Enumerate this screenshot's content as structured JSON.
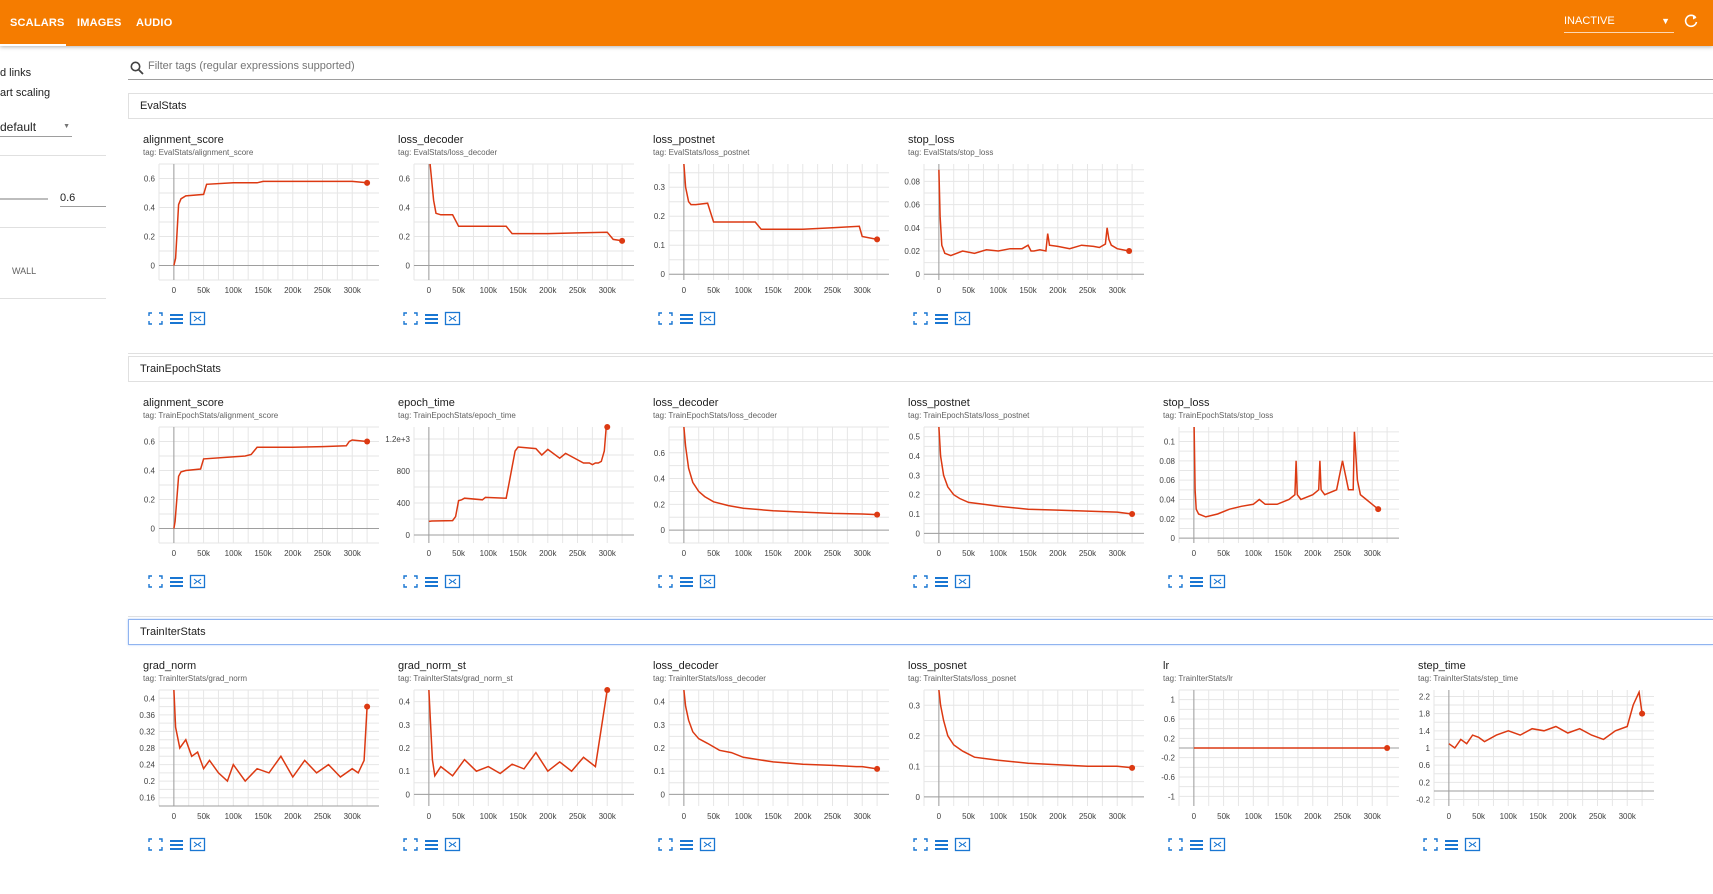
{
  "header": {
    "tabs": [
      {
        "label": "SCALARS",
        "active": true
      },
      {
        "label": "IMAGES",
        "active": false
      },
      {
        "label": "AUDIO",
        "active": false
      }
    ],
    "status_value": "INACTIVE",
    "bar_color": "#f57c00"
  },
  "sidebar": {
    "option_links": "d links",
    "option_scaling": "art scaling",
    "tooltip_sorting": "default",
    "smoothing_value": "0.6",
    "axis_wall": "WALL"
  },
  "search": {
    "placeholder": "Filter tags (regular expressions supported)"
  },
  "groups": [
    {
      "name": "EvalStats",
      "selected": false
    },
    {
      "name": "TrainEpochStats",
      "selected": false
    },
    {
      "name": "TrainIterStats",
      "selected": true
    }
  ],
  "series_color": "#dc3912",
  "cards": [
    {
      "title": "alignment_score",
      "tag": "tag: EvalStats/alignment_score",
      "yticks": [
        "0.6",
        "0.4",
        "0.2",
        "0"
      ],
      "xticks": [
        "0",
        "50k",
        "100k",
        "150k",
        "200k",
        "250k",
        "300k"
      ]
    },
    {
      "title": "loss_decoder",
      "tag": "tag: EvalStats/loss_decoder",
      "yticks": [
        "0.6",
        "0.4",
        "0.2",
        "0"
      ],
      "xticks": [
        "0",
        "50k",
        "100k",
        "150k",
        "200k",
        "250k",
        "300k"
      ]
    },
    {
      "title": "loss_postnet",
      "tag": "tag: EvalStats/loss_postnet",
      "yticks": [
        "0.3",
        "0.2",
        "0.1",
        "0"
      ],
      "xticks": [
        "0",
        "50k",
        "100k",
        "150k",
        "200k",
        "250k",
        "300k"
      ]
    },
    {
      "title": "stop_loss",
      "tag": "tag: EvalStats/stop_loss",
      "yticks": [
        "0.08",
        "0.06",
        "0.04",
        "0.02",
        "0"
      ],
      "xticks": [
        "0",
        "50k",
        "100k",
        "150k",
        "200k",
        "250k",
        "300k"
      ]
    },
    {
      "title": "alignment_score",
      "tag": "tag: TrainEpochStats/alignment_score",
      "yticks": [
        "0.6",
        "0.4",
        "0.2",
        "0"
      ],
      "xticks": [
        "0",
        "50k",
        "100k",
        "150k",
        "200k",
        "250k",
        "300k"
      ]
    },
    {
      "title": "epoch_time",
      "tag": "tag: TrainEpochStats/epoch_time",
      "yticks": [
        "1.2e+3",
        "800",
        "400",
        "0"
      ],
      "xticks": [
        "0",
        "50k",
        "100k",
        "150k",
        "200k",
        "250k",
        "300k"
      ]
    },
    {
      "title": "loss_decoder",
      "tag": "tag: TrainEpochStats/loss_decoder",
      "yticks": [
        "0.6",
        "0.4",
        "0.2",
        "0"
      ],
      "xticks": [
        "0",
        "50k",
        "100k",
        "150k",
        "200k",
        "250k",
        "300k"
      ]
    },
    {
      "title": "loss_postnet",
      "tag": "tag: TrainEpochStats/loss_postnet",
      "yticks": [
        "0.5",
        "0.4",
        "0.3",
        "0.2",
        "0.1",
        "0"
      ],
      "xticks": [
        "0",
        "50k",
        "100k",
        "150k",
        "200k",
        "250k",
        "300k"
      ]
    },
    {
      "title": "stop_loss",
      "tag": "tag: TrainEpochStats/stop_loss",
      "yticks": [
        "0.1",
        "0.08",
        "0.06",
        "0.04",
        "0.02",
        "0"
      ],
      "xticks": [
        "0",
        "50k",
        "100k",
        "150k",
        "200k",
        "250k",
        "300k"
      ]
    },
    {
      "title": "grad_norm",
      "tag": "tag: TrainIterStats/grad_norm",
      "yticks": [
        "0.4",
        "0.36",
        "0.32",
        "0.28",
        "0.24",
        "0.2",
        "0.16"
      ],
      "xticks": [
        "0",
        "50k",
        "100k",
        "150k",
        "200k",
        "250k",
        "300k"
      ]
    },
    {
      "title": "grad_norm_st",
      "tag": "tag: TrainIterStats/grad_norm_st",
      "yticks": [
        "0.4",
        "0.3",
        "0.2",
        "0.1",
        "0"
      ],
      "xticks": [
        "0",
        "50k",
        "100k",
        "150k",
        "200k",
        "250k",
        "300k"
      ]
    },
    {
      "title": "loss_decoder",
      "tag": "tag: TrainIterStats/loss_decoder",
      "yticks": [
        "0.4",
        "0.3",
        "0.2",
        "0.1",
        "0"
      ],
      "xticks": [
        "0",
        "50k",
        "100k",
        "150k",
        "200k",
        "250k",
        "300k"
      ]
    },
    {
      "title": "loss_posnet",
      "tag": "tag: TrainIterStats/loss_posnet",
      "yticks": [
        "0.3",
        "0.2",
        "0.1",
        "0"
      ],
      "xticks": [
        "0",
        "50k",
        "100k",
        "150k",
        "200k",
        "250k",
        "300k"
      ]
    },
    {
      "title": "lr",
      "tag": "tag: TrainIterStats/lr",
      "yticks": [
        "1",
        "0.6",
        "0.2",
        "-0.2",
        "-0.6",
        "-1"
      ],
      "xticks": [
        "0",
        "50k",
        "100k",
        "150k",
        "200k",
        "250k",
        "300k"
      ]
    },
    {
      "title": "step_time",
      "tag": "tag: TrainIterStats/step_time",
      "yticks": [
        "2.2",
        "1.8",
        "1.4",
        "1",
        "0.6",
        "0.2",
        "-0.2"
      ],
      "xticks": [
        "0",
        "50k",
        "100k",
        "150k",
        "200k",
        "250k",
        "300k"
      ]
    }
  ],
  "chart_data": [
    {
      "type": "line",
      "x": [
        0,
        3000,
        8000,
        12000,
        20000,
        50000,
        55000,
        100000,
        140000,
        150000,
        200000,
        250000,
        300000,
        325000
      ],
      "series": [
        {
          "values": [
            0,
            0.05,
            0.42,
            0.46,
            0.48,
            0.49,
            0.56,
            0.57,
            0.57,
            0.58,
            0.58,
            0.58,
            0.58,
            0.57
          ]
        }
      ],
      "ylim": [
        -0.1,
        0.7
      ],
      "xlim": [
        -25000,
        345000
      ]
    },
    {
      "type": "line",
      "x": [
        0,
        2000,
        8000,
        12000,
        20000,
        40000,
        50000,
        100000,
        130000,
        140000,
        200000,
        250000,
        300000,
        310000,
        325000
      ],
      "series": [
        {
          "values": [
            0.9,
            0.7,
            0.45,
            0.36,
            0.35,
            0.35,
            0.27,
            0.27,
            0.27,
            0.22,
            0.22,
            0.225,
            0.23,
            0.18,
            0.17
          ]
        }
      ],
      "ylim": [
        -0.1,
        0.7
      ],
      "xlim": [
        -25000,
        345000
      ]
    },
    {
      "type": "line",
      "x": [
        0,
        3000,
        8000,
        12000,
        20000,
        40000,
        50000,
        100000,
        120000,
        130000,
        200000,
        250000,
        295000,
        300000,
        325000
      ],
      "series": [
        {
          "values": [
            0.38,
            0.3,
            0.25,
            0.24,
            0.24,
            0.245,
            0.18,
            0.18,
            0.18,
            0.155,
            0.155,
            0.16,
            0.165,
            0.13,
            0.12
          ]
        }
      ],
      "ylim": [
        -0.02,
        0.38
      ],
      "xlim": [
        -25000,
        345000
      ]
    },
    {
      "type": "line",
      "x": [
        0,
        2000,
        5000,
        10000,
        20000,
        40000,
        60000,
        80000,
        100000,
        120000,
        140000,
        150000,
        155000,
        160000,
        170000,
        180000,
        183000,
        186000,
        200000,
        220000,
        240000,
        260000,
        270000,
        280000,
        283000,
        286000,
        290000,
        300000,
        320000
      ],
      "series": [
        {
          "values": [
            0.09,
            0.05,
            0.025,
            0.018,
            0.016,
            0.02,
            0.018,
            0.021,
            0.02,
            0.022,
            0.022,
            0.025,
            0.02,
            0.02,
            0.021,
            0.02,
            0.035,
            0.025,
            0.024,
            0.022,
            0.025,
            0.024,
            0.023,
            0.026,
            0.04,
            0.03,
            0.025,
            0.022,
            0.02
          ]
        }
      ],
      "ylim": [
        -0.005,
        0.095
      ],
      "xlim": [
        -25000,
        345000
      ]
    },
    {
      "type": "line",
      "x": [
        0,
        2000,
        8000,
        12000,
        20000,
        45000,
        50000,
        120000,
        130000,
        140000,
        200000,
        250000,
        290000,
        295000,
        300000,
        325000
      ],
      "series": [
        {
          "values": [
            0,
            0.05,
            0.36,
            0.39,
            0.4,
            0.41,
            0.48,
            0.5,
            0.51,
            0.56,
            0.56,
            0.565,
            0.57,
            0.6,
            0.61,
            0.6
          ]
        }
      ],
      "ylim": [
        -0.1,
        0.7
      ],
      "xlim": [
        -25000,
        345000
      ]
    },
    {
      "type": "line",
      "x": [
        0,
        5000,
        40000,
        45000,
        50000,
        55000,
        60000,
        90000,
        95000,
        130000,
        135000,
        140000,
        145000,
        150000,
        180000,
        190000,
        200000,
        220000,
        230000,
        260000,
        270000,
        275000,
        280000,
        285000,
        290000,
        295000,
        300000
      ],
      "series": [
        {
          "values": [
            170,
            175,
            180,
            230,
            430,
            440,
            460,
            440,
            470,
            460,
            650,
            850,
            1050,
            1100,
            1080,
            1000,
            1070,
            960,
            1020,
            900,
            900,
            880,
            900,
            900,
            920,
            1050,
            1500
          ]
        }
      ],
      "ylim": [
        -100,
        1350
      ],
      "xlim": [
        -25000,
        345000
      ]
    },
    {
      "type": "line",
      "x": [
        0,
        3000,
        8000,
        15000,
        25000,
        35000,
        50000,
        75000,
        100000,
        150000,
        200000,
        250000,
        300000,
        325000
      ],
      "series": [
        {
          "values": [
            0.8,
            0.65,
            0.48,
            0.37,
            0.3,
            0.26,
            0.22,
            0.19,
            0.17,
            0.15,
            0.14,
            0.13,
            0.125,
            0.12
          ]
        }
      ],
      "ylim": [
        -0.1,
        0.8
      ],
      "xlim": [
        -25000,
        345000
      ]
    },
    {
      "type": "line",
      "x": [
        0,
        3000,
        8000,
        15000,
        25000,
        35000,
        50000,
        75000,
        100000,
        150000,
        200000,
        250000,
        300000,
        325000
      ],
      "series": [
        {
          "values": [
            0.55,
            0.4,
            0.3,
            0.24,
            0.2,
            0.18,
            0.16,
            0.15,
            0.14,
            0.125,
            0.12,
            0.115,
            0.11,
            0.1
          ]
        }
      ],
      "ylim": [
        -0.05,
        0.55
      ],
      "xlim": [
        -25000,
        345000
      ]
    },
    {
      "type": "line",
      "x": [
        0,
        2000,
        4000,
        8000,
        20000,
        40000,
        60000,
        80000,
        100000,
        110000,
        120000,
        140000,
        160000,
        170000,
        172000,
        174000,
        180000,
        200000,
        210000,
        212000,
        214000,
        220000,
        240000,
        250000,
        260000,
        268000,
        270000,
        275000,
        280000,
        290000,
        300000,
        310000
      ],
      "series": [
        {
          "values": [
            0.13,
            0.05,
            0.03,
            0.025,
            0.022,
            0.025,
            0.03,
            0.033,
            0.035,
            0.04,
            0.035,
            0.035,
            0.04,
            0.045,
            0.08,
            0.045,
            0.04,
            0.045,
            0.05,
            0.08,
            0.05,
            0.045,
            0.05,
            0.08,
            0.05,
            0.05,
            0.11,
            0.06,
            0.045,
            0.04,
            0.035,
            0.03
          ]
        }
      ],
      "ylim": [
        -0.005,
        0.115
      ],
      "xlim": [
        -25000,
        345000
      ]
    },
    {
      "type": "line",
      "x": [
        0,
        3000,
        10000,
        20000,
        30000,
        40000,
        50000,
        60000,
        75000,
        90000,
        100000,
        110000,
        120000,
        140000,
        160000,
        180000,
        200000,
        220000,
        240000,
        260000,
        280000,
        300000,
        310000,
        320000,
        325000
      ],
      "series": [
        {
          "values": [
            0.42,
            0.33,
            0.28,
            0.3,
            0.26,
            0.27,
            0.23,
            0.25,
            0.22,
            0.2,
            0.24,
            0.22,
            0.2,
            0.23,
            0.22,
            0.26,
            0.21,
            0.25,
            0.22,
            0.24,
            0.21,
            0.23,
            0.22,
            0.25,
            0.38
          ]
        }
      ],
      "ylim": [
        0.14,
        0.42
      ],
      "xlim": [
        -25000,
        345000
      ]
    },
    {
      "type": "line",
      "x": [
        0,
        3000,
        6000,
        10000,
        20000,
        40000,
        60000,
        80000,
        100000,
        120000,
        140000,
        160000,
        180000,
        200000,
        220000,
        240000,
        260000,
        280000,
        300000
      ],
      "series": [
        {
          "values": [
            0.45,
            0.3,
            0.15,
            0.08,
            0.12,
            0.08,
            0.15,
            0.1,
            0.12,
            0.09,
            0.13,
            0.11,
            0.18,
            0.1,
            0.14,
            0.1,
            0.16,
            0.12,
            0.45
          ]
        }
      ],
      "ylim": [
        -0.05,
        0.45
      ],
      "xlim": [
        -25000,
        345000
      ]
    },
    {
      "type": "line",
      "x": [
        0,
        3000,
        8000,
        15000,
        25000,
        40000,
        60000,
        80000,
        100000,
        150000,
        200000,
        250000,
        290000,
        300000,
        325000
      ],
      "series": [
        {
          "values": [
            0.45,
            0.38,
            0.32,
            0.27,
            0.24,
            0.22,
            0.19,
            0.18,
            0.16,
            0.14,
            0.13,
            0.125,
            0.12,
            0.12,
            0.11
          ]
        }
      ],
      "ylim": [
        -0.05,
        0.45
      ],
      "xlim": [
        -25000,
        345000
      ]
    },
    {
      "type": "line",
      "x": [
        0,
        3000,
        8000,
        15000,
        25000,
        40000,
        60000,
        80000,
        100000,
        150000,
        200000,
        250000,
        290000,
        300000,
        325000
      ],
      "series": [
        {
          "values": [
            0.35,
            0.3,
            0.25,
            0.2,
            0.17,
            0.15,
            0.13,
            0.125,
            0.12,
            0.11,
            0.105,
            0.1,
            0.1,
            0.1,
            0.095
          ]
        }
      ],
      "ylim": [
        -0.03,
        0.35
      ],
      "xlim": [
        -25000,
        345000
      ]
    },
    {
      "type": "line",
      "x": [
        0,
        325000
      ],
      "series": [
        {
          "values": [
            0,
            0
          ]
        }
      ],
      "ylim": [
        -1.2,
        1.2
      ],
      "xlim": [
        -25000,
        345000
      ]
    },
    {
      "type": "line",
      "x": [
        0,
        10000,
        20000,
        30000,
        40000,
        50000,
        60000,
        80000,
        100000,
        120000,
        140000,
        160000,
        180000,
        200000,
        220000,
        240000,
        260000,
        280000,
        300000,
        310000,
        320000,
        325000
      ],
      "series": [
        {
          "values": [
            1.1,
            1.0,
            1.2,
            1.1,
            1.3,
            1.25,
            1.15,
            1.3,
            1.4,
            1.3,
            1.45,
            1.4,
            1.5,
            1.35,
            1.45,
            1.3,
            1.2,
            1.4,
            1.5,
            2.0,
            2.3,
            1.8
          ]
        }
      ],
      "ylim": [
        -0.35,
        2.35
      ],
      "xlim": [
        -25000,
        345000
      ]
    }
  ]
}
